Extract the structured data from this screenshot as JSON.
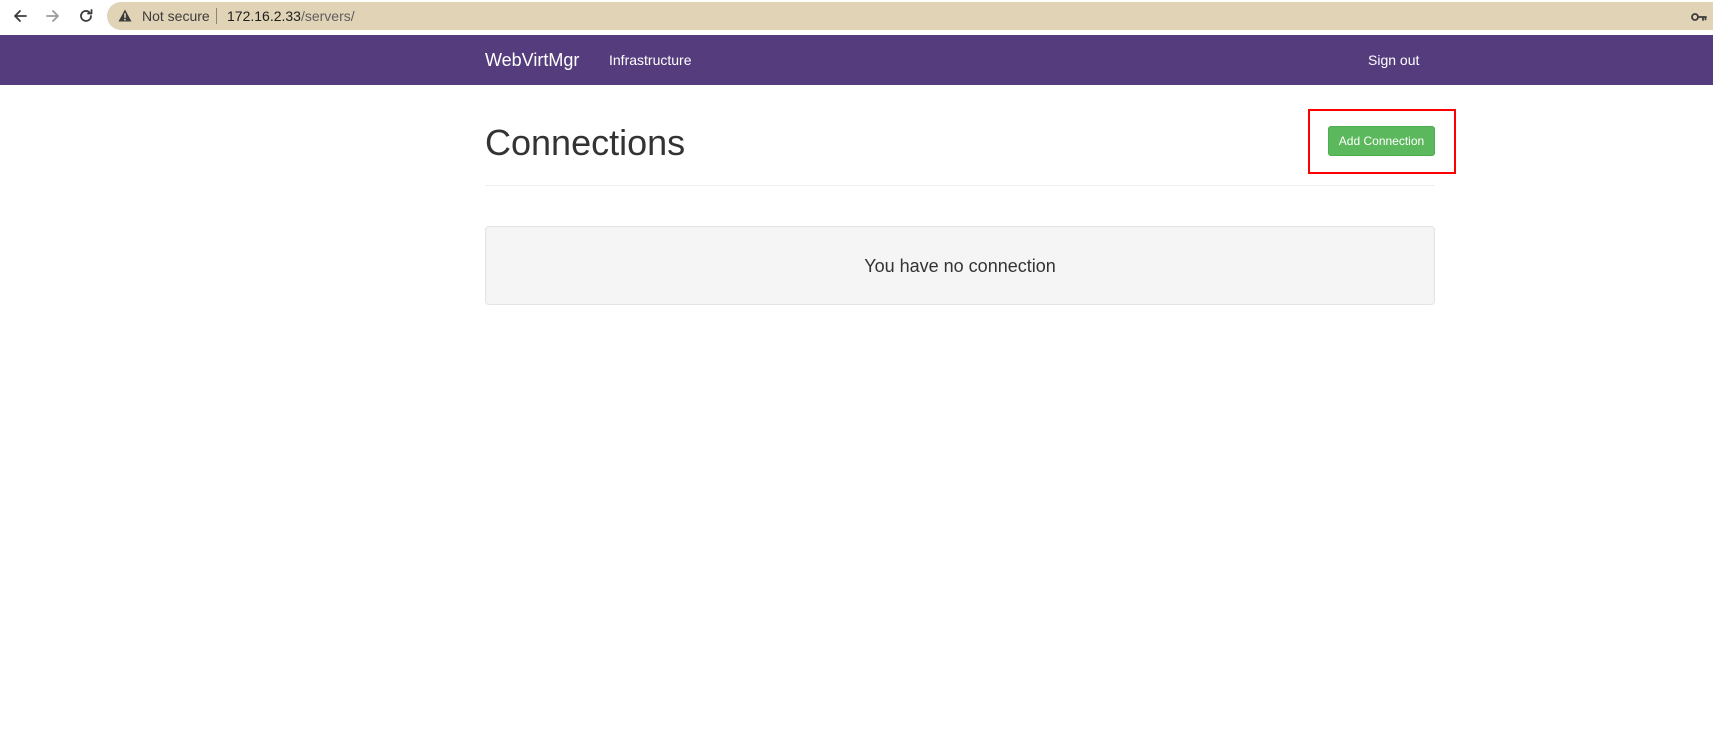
{
  "browser": {
    "security_label": "Not secure",
    "url_host": "172.16.2.33",
    "url_path": "/servers/"
  },
  "navbar": {
    "brand": "WebVirtMgr",
    "links": [
      {
        "label": "Infrastructure"
      }
    ],
    "sign_out": "Sign out",
    "background_color": "#553d7d"
  },
  "page": {
    "title": "Connections",
    "add_button_label": "Add Connection",
    "empty_message": "You have no connection"
  },
  "colors": {
    "button_green": "#5cb85c",
    "highlight_red": "#ff0000",
    "omnibox_tan": "#e0d3b6"
  },
  "icons": {
    "back": "back-arrow-icon",
    "forward": "forward-arrow-icon",
    "reload": "reload-icon",
    "warning": "warning-triangle-icon",
    "key": "key-icon"
  }
}
